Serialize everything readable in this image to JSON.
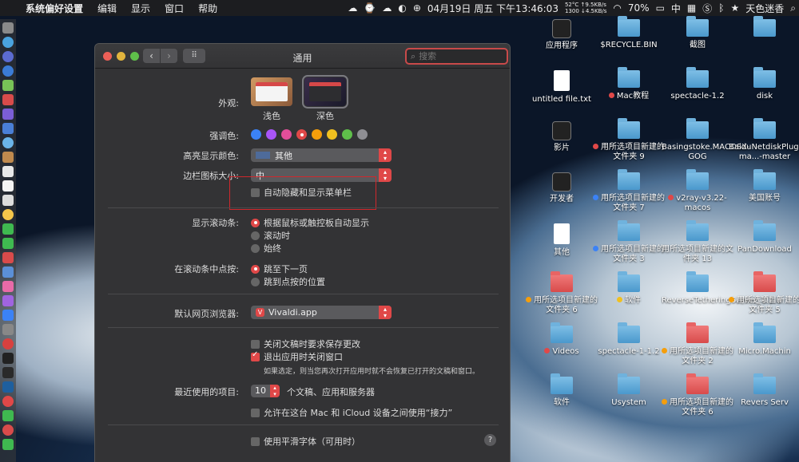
{
  "menubar": {
    "app_name": "系统偏好设置",
    "items": [
      "编辑",
      "显示",
      "窗口",
      "帮助"
    ],
    "net_up": "52°C ↑9.5KB/s",
    "net_down": "1300 ↓4.5KB/s",
    "datetime": "04月19日 周五 下午13:46:03",
    "battery": "70%",
    "input_method": "中",
    "user": "天色迷香"
  },
  "window": {
    "title": "通用",
    "search_placeholder": "搜索",
    "appearance": {
      "label": "外观:",
      "options": [
        "浅色",
        "深色"
      ],
      "selected": "深色"
    },
    "accent": {
      "label": "强调色:",
      "colors": [
        "#3b82f6",
        "#a855f7",
        "#e24e9a",
        "#e04848",
        "#f59e0b",
        "#f0c020",
        "#5fbf4a",
        "#8e8e93"
      ],
      "selected_index": 3
    },
    "highlight": {
      "label": "高亮显示颜色:",
      "value": "其他",
      "swatch": "#4e6b9a"
    },
    "sidebar_size": {
      "label": "边栏图标大小:",
      "value": "中"
    },
    "auto_hide_menu": {
      "label": "自动隐藏和显示菜单栏",
      "checked": false
    },
    "scrollbars": {
      "label": "显示滚动条:",
      "options": [
        "根据鼠标或触控板自动显示",
        "滚动时",
        "始终"
      ],
      "selected": 0
    },
    "click_scroll": {
      "label": "在滚动条中点按:",
      "options": [
        "跳至下一页",
        "跳到点按的位置"
      ],
      "selected": 0
    },
    "browser": {
      "label": "默认网页浏览器:",
      "value": "Vivaldi.app"
    },
    "ask_save": {
      "label": "关闭文稿时要求保存更改",
      "checked": false
    },
    "close_windows": {
      "label": "退出应用时关闭窗口",
      "checked": true
    },
    "close_windows_note": "如果选定，则当您再次打开应用时就不会恢复已打开的文稿和窗口。",
    "recent": {
      "label": "最近使用的项目:",
      "value": "10",
      "suffix": "个文稿、应用和服务器"
    },
    "handoff": {
      "label": "允许在这台 Mac 和 iCloud 设备之间使用“接力”",
      "checked": false
    },
    "smooth_fonts": {
      "label": "使用平滑字体（可用时）",
      "checked": false
    },
    "help": "?"
  },
  "desktop": {
    "icons": [
      {
        "label": "应用程序",
        "type": "app"
      },
      {
        "label": "$RECYCLE.BIN",
        "type": "folder"
      },
      {
        "label": "截图",
        "type": "folder"
      },
      {
        "label": "",
        "type": "folder"
      },
      {
        "label": "untitled file.txt",
        "type": "file"
      },
      {
        "label": "Mac教程",
        "type": "folder",
        "tag": "#e04848"
      },
      {
        "label": "spectacle-1.2",
        "type": "folder"
      },
      {
        "label": "disk",
        "type": "folder"
      },
      {
        "label": "影片",
        "type": "app"
      },
      {
        "label": "用所选项目新建的文件夹 9",
        "type": "folder",
        "tag": "#e04848"
      },
      {
        "label": "Basingstoke.MACOSX-GOG",
        "type": "folder"
      },
      {
        "label": "BaiduNetdiskPlugin-ma...-master",
        "type": "folder"
      },
      {
        "label": "开发者",
        "type": "app"
      },
      {
        "label": "用所选项目新建的文件夹 7",
        "type": "folder",
        "tag": "#3b82f6"
      },
      {
        "label": "v2ray-v3.22-macos",
        "type": "folder",
        "tag": "#e04848"
      },
      {
        "label": "美国账号",
        "type": "folder"
      },
      {
        "label": "其他",
        "type": "file"
      },
      {
        "label": "用所选项目新建的文件夹 3",
        "type": "folder",
        "tag": "#3b82f6"
      },
      {
        "label": "用所选项目新建的文件夹 13",
        "type": "folder"
      },
      {
        "label": "PanDownload",
        "type": "folder"
      },
      {
        "label": "用所选项目新建的文件夹 6",
        "type": "folder red",
        "tag": "#f59e0b"
      },
      {
        "label": "软件",
        "type": "folder",
        "tag": "#f0c020"
      },
      {
        "label": "ReverseTetheringServer_1.2.0",
        "type": "folder"
      },
      {
        "label": "用所选项目新建的文件夹 5",
        "type": "folder red",
        "tag": "#f59e0b"
      },
      {
        "label": "Videos",
        "type": "folder",
        "tag": "#e04848"
      },
      {
        "label": "spectacle-1-1.2",
        "type": "folder"
      },
      {
        "label": "用所选项目新建的文件夹 2",
        "type": "folder red",
        "tag": "#f59e0b"
      },
      {
        "label": "Micro.Machin",
        "type": "folder"
      },
      {
        "label": "软件",
        "type": "folder"
      },
      {
        "label": "Usystem",
        "type": "folder"
      },
      {
        "label": "用所选项目新建的文件夹 6",
        "type": "folder red",
        "tag": "#f59e0b"
      },
      {
        "label": "Revers Serv",
        "type": "folder"
      }
    ]
  }
}
